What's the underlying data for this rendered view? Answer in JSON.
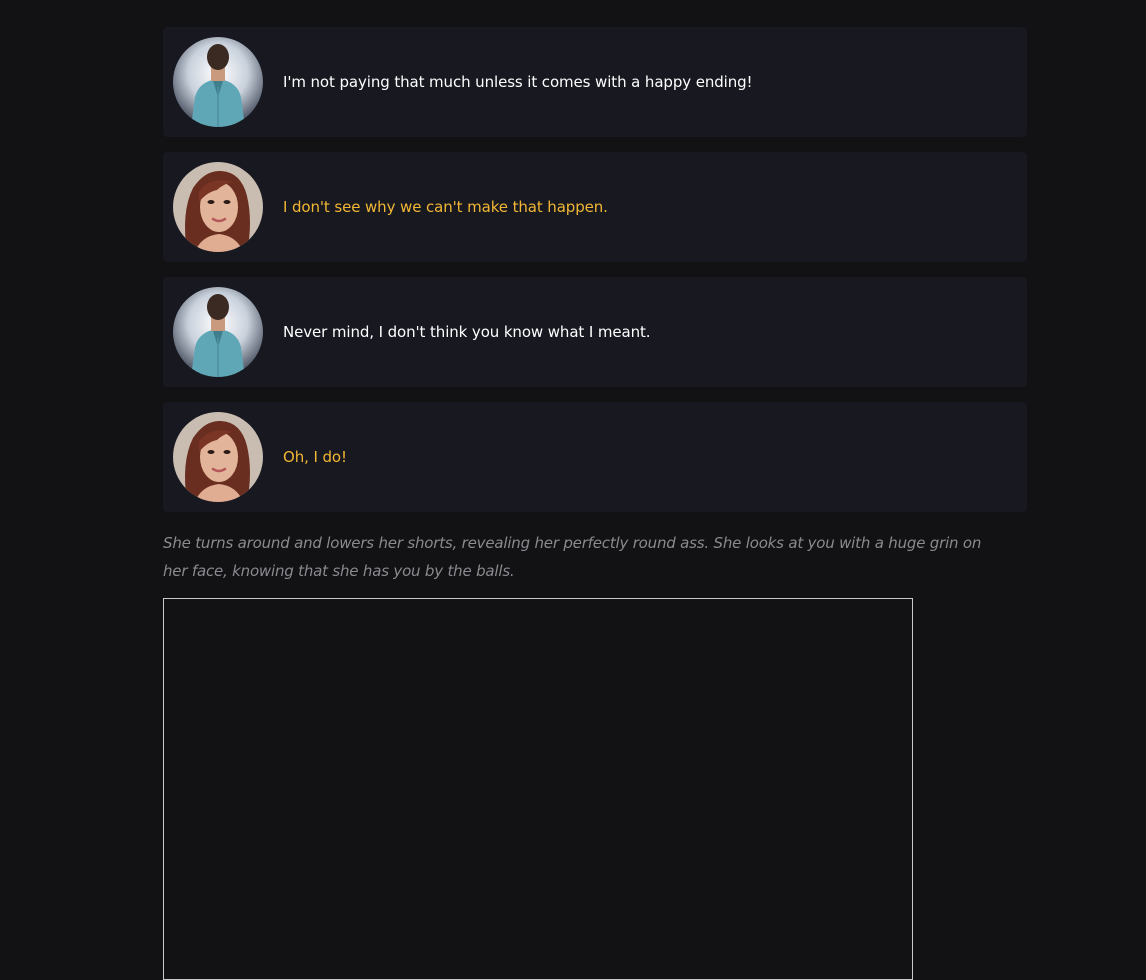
{
  "dialogue": [
    {
      "speaker": "male",
      "avatar_icon": "man-back-avatar",
      "text": "I'm not paying that much unless it comes with a happy ending!"
    },
    {
      "speaker": "female",
      "avatar_icon": "woman-portrait-avatar",
      "text": "I don't see why we can't make that happen."
    },
    {
      "speaker": "male",
      "avatar_icon": "man-back-avatar",
      "text": "Never mind, I don't think you know what I meant."
    },
    {
      "speaker": "female",
      "avatar_icon": "woman-portrait-avatar",
      "text": "Oh, I do!"
    }
  ],
  "narration": "She turns around and lowers her shorts, revealing her perfectly round ass. She looks at you with a huge grin on her face, knowing that she has you by the balls.",
  "colors": {
    "background": "#121114",
    "bubble": "#171820",
    "male_text": "#ffffff",
    "female_text": "#f2b734",
    "narration_text": "#8a8a8f"
  }
}
